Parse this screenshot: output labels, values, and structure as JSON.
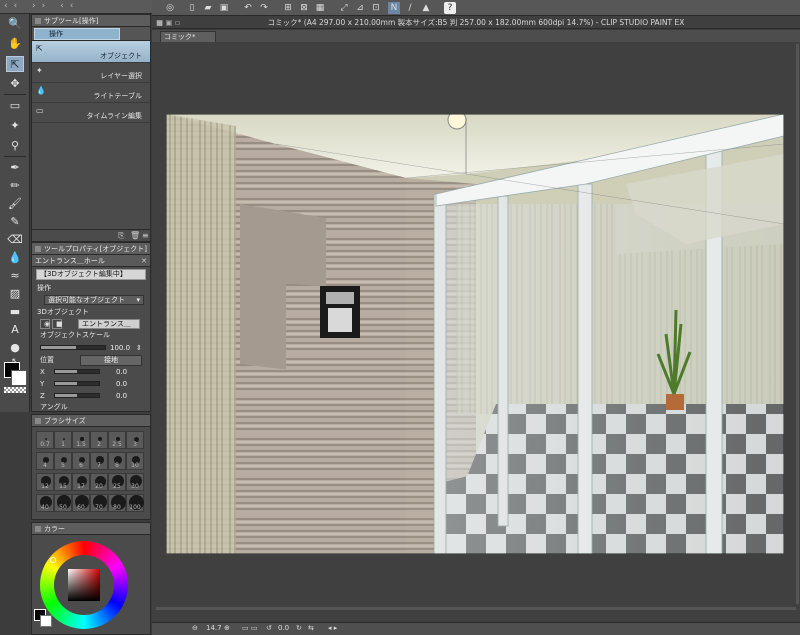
{
  "window": {
    "title": "コミック* (A4 297.00 x 210.00mm 製本サイズ:B5 判 257.00 x 182.00mm 600dpi 14.7%)  - CLIP STUDIO PAINT EX",
    "doc_tab": "コミック*"
  },
  "subtool_panel": {
    "title": "サブツール[操作]",
    "group_tab": "操作",
    "items": [
      {
        "label": "オブジェクト",
        "icon": "object-arrow-icon",
        "selected": true
      },
      {
        "label": "レイヤー選択",
        "icon": "layer-select-icon",
        "selected": false
      },
      {
        "label": "ライトテーブル",
        "icon": "light-table-icon",
        "selected": false
      },
      {
        "label": "タイムライン編集",
        "icon": "timeline-icon",
        "selected": false
      }
    ]
  },
  "tool_property": {
    "title": "ツールプロパティ[オブジェクト]",
    "object_name": "エントランス＿ホール",
    "editing_badge": "【3Dオブジェクト編集中】",
    "operation_label": "操作",
    "operation_value": "選択可能なオブジェクト",
    "object3d_label": "3Dオブジェクト",
    "object3d_value": "エントランス＿",
    "scale_label": "オブジェクトスケール",
    "scale_value": "100.0",
    "position_label": "位置",
    "ground_button": "接地",
    "x_label": "X",
    "x_value": "0.0",
    "y_label": "Y",
    "y_value": "0.0",
    "z_label": "Z",
    "z_value": "0.0",
    "angle_label": "アングル"
  },
  "brush_panel": {
    "title": "ブラシサイズ",
    "sizes": [
      "0.7",
      "1",
      "1.5",
      "2",
      "2.5",
      "3",
      "4",
      "5",
      "6",
      "7",
      "8",
      "10",
      "12",
      "15",
      "17",
      "20",
      "25",
      "30",
      "40",
      "50",
      "60",
      "70",
      "80",
      "100"
    ]
  },
  "color_panel": {
    "title": "カラー"
  },
  "status": {
    "zoom": "14.7",
    "angle": "0.0"
  },
  "colors": {
    "accent_selected": "#8fb2cd",
    "panel_bg": "#4b4b4b",
    "canvas_bg": "#404040",
    "primary_color": "#000000",
    "secondary_color": "#ffffff"
  }
}
